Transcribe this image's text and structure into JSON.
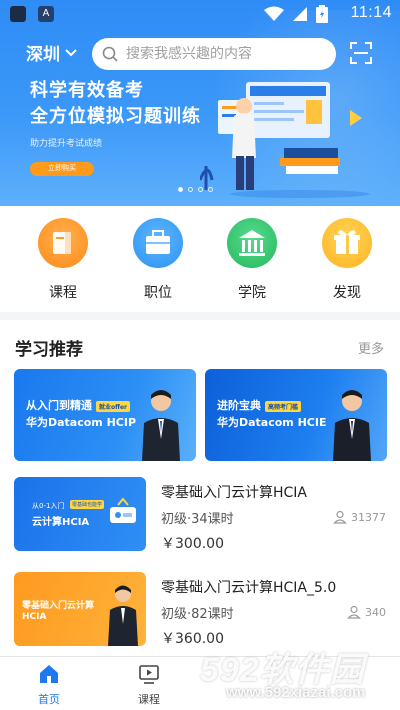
{
  "status_bar": {
    "time": "11:14",
    "app_badge": "A"
  },
  "header": {
    "city": "深圳",
    "search_placeholder": "搜索我感兴趣的内容"
  },
  "hero": {
    "line1": "科学有效备考",
    "line2": "全方位模拟习题训练",
    "subtitle": "助力提升考试成绩",
    "button_label": "立即购买",
    "slide_count": 4,
    "active_slide": 1
  },
  "quick_nav": [
    {
      "label": "课程",
      "icon": "book-icon",
      "color": "#ff9324"
    },
    {
      "label": "职位",
      "icon": "briefcase-icon",
      "color": "#2d98f5"
    },
    {
      "label": "学院",
      "icon": "institution-icon",
      "color": "#2fc36a"
    },
    {
      "label": "发现",
      "icon": "gift-icon",
      "color": "#ffbf2a"
    }
  ],
  "recommend": {
    "title": "学习推荐",
    "more": "更多",
    "banners": [
      {
        "line1": "从入门到精通",
        "tag": "就业offer",
        "line2": "华为Datacom HCIP"
      },
      {
        "line1": "进阶宝典",
        "tag": "高频考门槛",
        "line2": "华为Datacom HCIE"
      }
    ],
    "courses": [
      {
        "title": "零基础入门云计算HCIA",
        "level": "初级·34课时",
        "price": "￥300.00",
        "students": "31377",
        "thumb_line1": "从0-1入门",
        "thumb_tag": "零基础也能学",
        "thumb_line2": "云计算HCIA"
      },
      {
        "title": "零基础入门云计算HCIA_5.0",
        "level": "初级·82课时",
        "price": "￥360.00",
        "students": "340",
        "thumb_line1": "零基础入门云计算",
        "thumb_line2": "HCIA"
      }
    ]
  },
  "bottom_nav": [
    {
      "label": "首页",
      "icon": "home-icon",
      "active": true
    },
    {
      "label": "课程",
      "icon": "play-screen-icon",
      "active": false
    }
  ],
  "watermark": {
    "big": "592软件园",
    "small": "www.592xiazai.com"
  },
  "colors": {
    "brand_blue": "#2f8cf6",
    "active_tab": "#1e78f0",
    "accent_orange": "#ff9a1a"
  }
}
